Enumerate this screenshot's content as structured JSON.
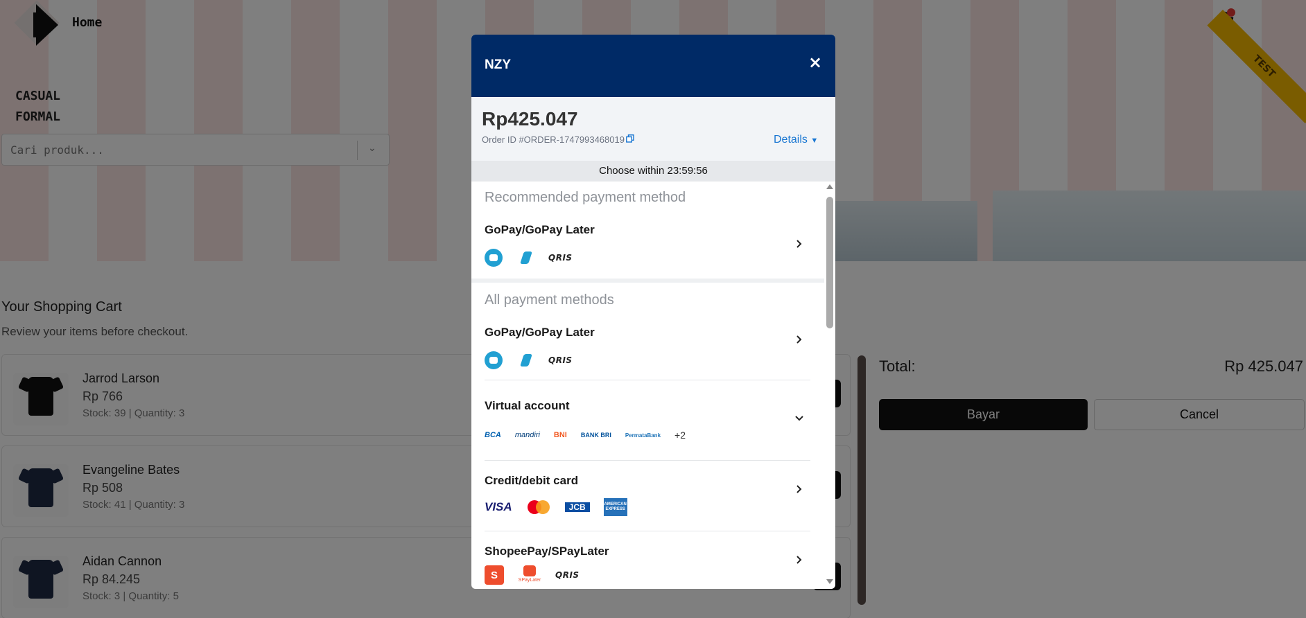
{
  "header": {
    "home_label": "Home",
    "ribbon_label": "TEST"
  },
  "sidebar": {
    "links": [
      "CASUAL",
      "FORMAL"
    ]
  },
  "search": {
    "placeholder": "Cari produk..."
  },
  "cart": {
    "title": "Your Shopping Cart",
    "subtitle": "Review your items before checkout.",
    "items": [
      {
        "name": "Jarrod Larson",
        "price": "Rp 766",
        "meta": "Stock: 39 | Quantity: 3",
        "shirt_color": "#111111"
      },
      {
        "name": "Evangeline Bates",
        "price": "Rp 508",
        "meta": "Stock: 41 | Quantity: 3",
        "shirt_color": "#1f2a44"
      },
      {
        "name": "Aidan Cannon",
        "price": "Rp 84.245",
        "meta": "Stock: 3 | Quantity: 5",
        "shirt_color": "#1f2a44"
      }
    ]
  },
  "summary": {
    "total_label": "Total:",
    "total_value": "Rp 425.047",
    "pay_label": "Bayar",
    "cancel_label": "Cancel"
  },
  "modal": {
    "merchant": "NZY",
    "close_glyph": "×",
    "amount": "Rp425.047",
    "order_id": "Order ID #ORDER-1747993468019",
    "details_label": "Details",
    "timer_text": "Choose within  23:59:56",
    "recommended_title": "Recommended payment method",
    "all_title": "All payment methods",
    "recommended": {
      "name": "GoPay/GoPay Later",
      "logos": [
        "gopay-icon",
        "gopay-later-icon",
        "QRIS"
      ]
    },
    "methods": [
      {
        "name": "GoPay/GoPay Later",
        "logos": [
          "gopay-icon",
          "gopay-later-icon",
          "QRIS"
        ],
        "chevron": "right"
      },
      {
        "name": "Virtual account",
        "logos": [
          "BCA",
          "mandiri",
          "BNI",
          "BANK BRI",
          "PermataBank"
        ],
        "more": "+2",
        "chevron": "down"
      },
      {
        "name": "Credit/debit card",
        "logos": [
          "VISA",
          "mastercard-icon",
          "JCB",
          "AMERICAN EXPRESS"
        ],
        "chevron": "right"
      },
      {
        "name": "ShopeePay/SPayLater",
        "logos": [
          "S",
          "SPayLater",
          "QRIS"
        ],
        "chevron": "right"
      }
    ],
    "colors": {
      "header": "#002a66",
      "link": "#1976d2",
      "gopay": "#21a0d2",
      "shopee": "#ee4d2d"
    }
  }
}
